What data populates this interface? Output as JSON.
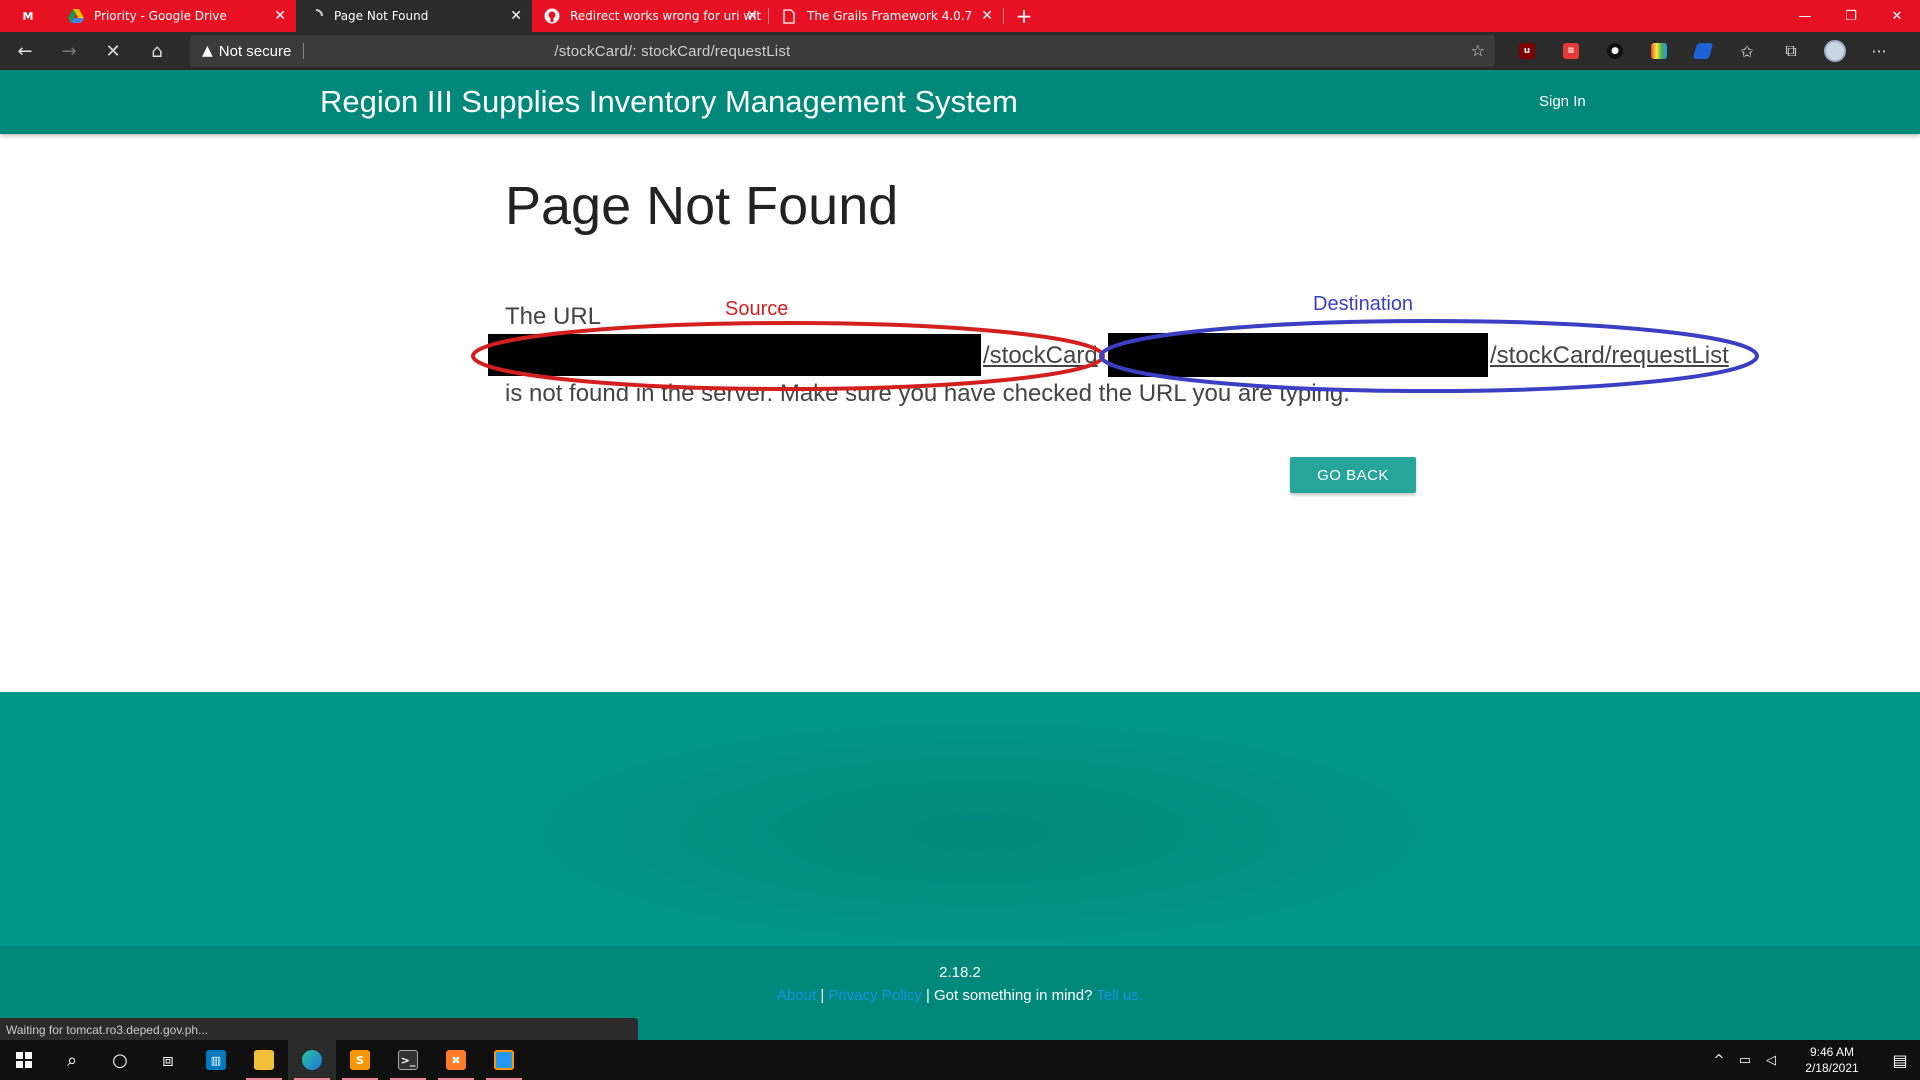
{
  "browser": {
    "tabs": [
      {
        "title": "",
        "favicon": "gmail-icon",
        "pinned": true
      },
      {
        "title": "Priority - Google Drive",
        "favicon": "google-drive-icon"
      },
      {
        "title": "Page Not Found",
        "favicon": "loading-spinner-icon",
        "active": true
      },
      {
        "title": "Redirect works wrong for uri wit",
        "favicon": "github-icon"
      },
      {
        "title": "The Grails Framework 4.0.7",
        "favicon": "document-icon"
      }
    ],
    "new_tab_symbol": "+",
    "security_text": "Not secure",
    "address_text": "/stockCard/:                          stockCard/requestList",
    "status_text": "Waiting for tomcat.ro3.deped.gov.ph..."
  },
  "app": {
    "brand": "Region III Supplies Inventory Management System",
    "signin": "Sign In"
  },
  "main": {
    "title": "Page Not Found",
    "msg_prefix": "The URL",
    "source_path": "/stockCard",
    "destination_path": "/stockCard/requestList",
    "msg_suffix": "is not found in the server. Make sure you have checked the URL you are typing.",
    "source_label": "Source",
    "destination_label": "Destination",
    "go_back": "GO BACK"
  },
  "footer": {
    "version": "2.18.2",
    "about": "About",
    "sep1": " | ",
    "privacy": "Privacy Policy",
    "sep2": " | ",
    "prompt": "Got something in mind? ",
    "tell": "Tell us."
  },
  "taskbar": {
    "time": "9:46 AM",
    "date": "2/18/2021"
  },
  "colors": {
    "tab_strip": "#e81123",
    "header": "#00897b",
    "footer": "#009688",
    "button": "#26a69a",
    "source_annotation": "#d41f1f",
    "destination_annotation": "#3b3fc4"
  }
}
